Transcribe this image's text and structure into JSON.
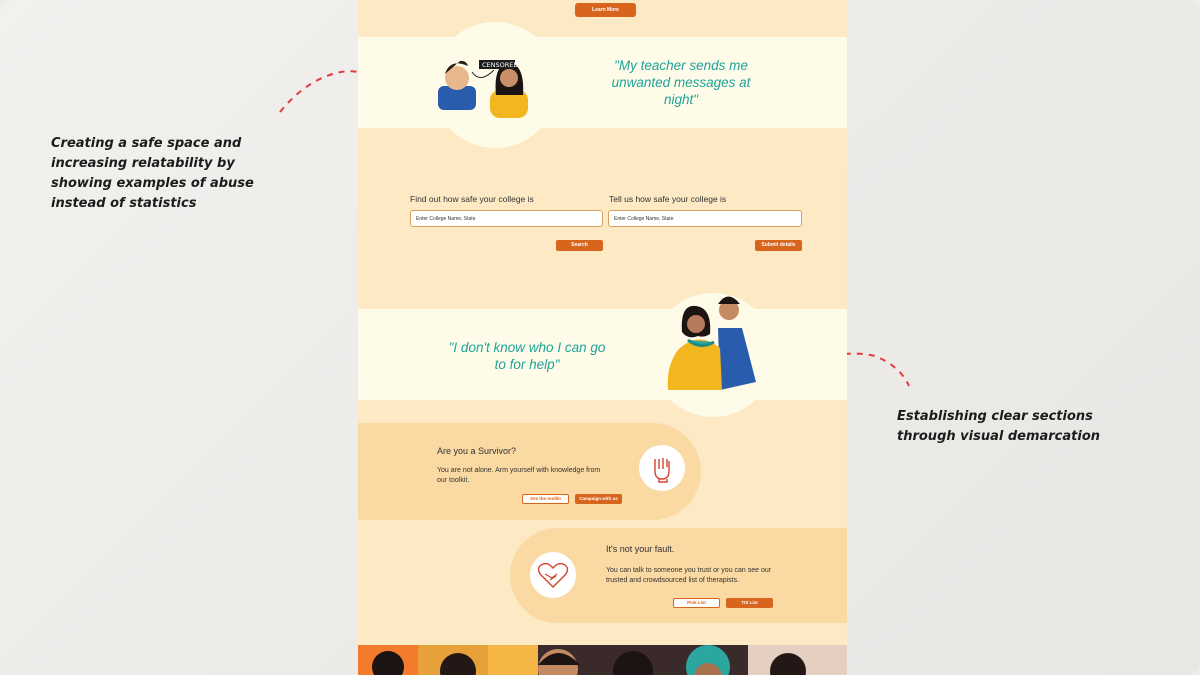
{
  "annotations": {
    "left": "Creating a safe space and increasing relatability by showing examples of abuse instead of statistics",
    "right": "Establishing clear sections through visual demarcation"
  },
  "hero": {
    "learn_more": "Learn More"
  },
  "quote1": {
    "text": "\"My teacher sends me unwanted messages at night\"",
    "censored_tag": "CENSORED"
  },
  "forms": {
    "find": {
      "label": "Find out how safe your college is",
      "placeholder": "Enter College Name, State",
      "button": "Search"
    },
    "tell": {
      "label": "Tell us how safe your college is",
      "placeholder": "Enter College Name, State",
      "button": "Submit details"
    }
  },
  "quote2": {
    "text": "\"I don't know who I can go to for help\""
  },
  "survivor": {
    "title": "Are you a Survivor?",
    "text": "You are not alone. Arm yourself with knowledge from our toolkit.",
    "btn_toolkit": "See the toolkit",
    "btn_campaign": "Campaign with us",
    "icon": "raised-fist-icon"
  },
  "fault": {
    "title": "It's not your fault.",
    "text": "You can talk to someone you trust or you can see our trusted and crowdsourced list of therapists.",
    "btn_pink": "Pink List",
    "btn_tis": "TIS List",
    "icon": "heart-handshake-icon"
  },
  "colors": {
    "accent": "#d7651e",
    "teal": "#1fa39a",
    "page_bg": "#fde9c4",
    "band": "#fefbe9",
    "card": "#fad9a3"
  }
}
